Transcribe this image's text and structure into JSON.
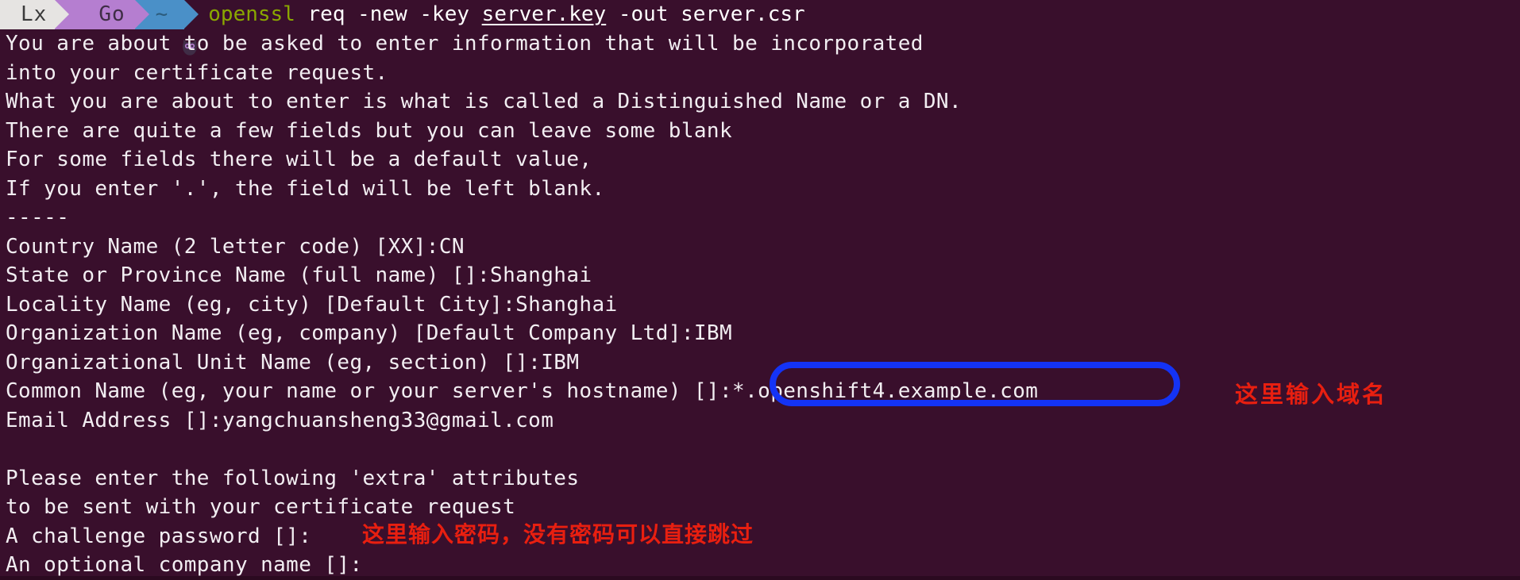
{
  "terminal": {
    "background_color": "#390f2c",
    "foreground_color": "#f2eef2",
    "prompt": {
      "segments": [
        {
          "name": "distro",
          "label": "Lx",
          "bg": "#e6e4e2",
          "fg": "#3b3b3b"
        },
        {
          "name": "context",
          "label": "Go",
          "icon": "owl-icon",
          "bg": "#b57ed0",
          "fg": "#3f2d46"
        },
        {
          "name": "directory",
          "label": "~",
          "bg": "#4a90c8",
          "fg": "#2c5c7d"
        }
      ]
    },
    "command": {
      "program": "openssl",
      "program_color": "#8aa800",
      "args_before_file": " req -new -key ",
      "underlined_file": "server.key",
      "args_after_file": " -out server.csr"
    },
    "output_lines": [
      "You are about to be asked to enter information that will be incorporated",
      "into your certificate request.",
      "What you are about to enter is what is called a Distinguished Name or a DN.",
      "There are quite a few fields but you can leave some blank",
      "For some fields there will be a default value,",
      "If you enter '.', the field will be left blank.",
      "-----",
      "Country Name (2 letter code) [XX]:CN",
      "State or Province Name (full name) []:Shanghai",
      "Locality Name (eg, city) [Default City]:Shanghai",
      "Organization Name (eg, company) [Default Company Ltd]:IBM",
      "Organizational Unit Name (eg, section) []:IBM",
      "Common Name (eg, your name or your server's hostname) []:*.openshift4.example.com",
      "Email Address []:yangchuansheng33@gmail.com",
      "",
      "Please enter the following 'extra' attributes",
      "to be sent with your certificate request",
      "A challenge password []: ",
      "An optional company name []:"
    ]
  },
  "annotations": {
    "highlight_box": {
      "color": "#1433f5",
      "target_text": "[]:*.openshift4.example.com"
    },
    "domain_note": {
      "text": "这里输入域名",
      "color": "#e81f10"
    },
    "password_note": {
      "text": "这里输入密码，没有密码可以直接跳过",
      "color": "#e81f10"
    }
  }
}
